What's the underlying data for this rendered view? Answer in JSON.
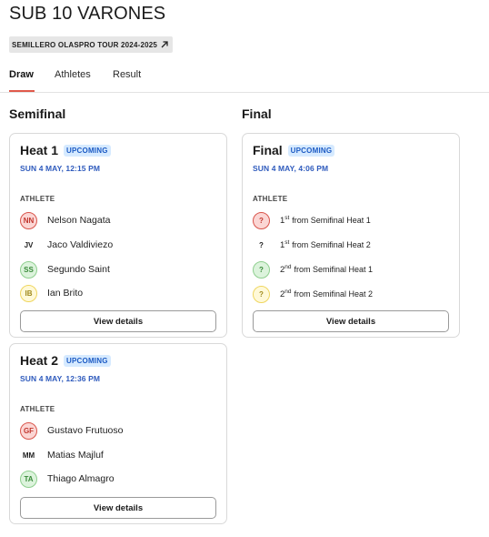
{
  "page": {
    "title": "SUB 10 VARONES"
  },
  "tour_tag": {
    "label": "SEMILLERO OLASPRO TOUR 2024-2025",
    "icon": "arrow-up-right-icon"
  },
  "tabs": [
    {
      "label": "Draw",
      "active": true
    },
    {
      "label": "Athletes",
      "active": false
    },
    {
      "label": "Result",
      "active": false
    }
  ],
  "columns": {
    "semifinal": "Semifinal",
    "final": "Final"
  },
  "heats": {
    "heat1": {
      "title": "Heat 1",
      "status": "UPCOMING",
      "datetime": "SUN 4 MAY, 12:15 PM",
      "athlete_label": "ATHLETE",
      "athletes": [
        {
          "initials": "NN",
          "name": "Nelson Nagata",
          "color": "#d9554c"
        },
        {
          "initials": "JV",
          "name": "Jaco Valdiviezo",
          "color": "#ffffff"
        },
        {
          "initials": "SS",
          "name": "Segundo Saint",
          "color": "#8fcf8f"
        },
        {
          "initials": "IB",
          "name": "Ian Brito",
          "color": "#efd660"
        }
      ],
      "button": "View details"
    },
    "heat2": {
      "title": "Heat 2",
      "status": "UPCOMING",
      "datetime": "SUN 4 MAY, 12:36 PM",
      "athlete_label": "ATHLETE",
      "athletes": [
        {
          "initials": "GF",
          "name": "Gustavo Frutuoso",
          "color": "#d9554c"
        },
        {
          "initials": "MM",
          "name": "Matias Majluf",
          "color": "#ffffff"
        },
        {
          "initials": "TA",
          "name": "Thiago Almagro",
          "color": "#8fcf8f"
        }
      ],
      "button": "View details"
    },
    "final": {
      "title": "Final",
      "status": "UPCOMING",
      "datetime": "SUN 4 MAY, 4:06 PM",
      "athlete_label": "ATHLETE",
      "slots": [
        {
          "initials": "?",
          "ord_num": "1",
          "ord_suffix": "st",
          "source": "from Semifinal Heat 1",
          "color": "#d9554c"
        },
        {
          "initials": "?",
          "ord_num": "1",
          "ord_suffix": "st",
          "source": "from Semifinal Heat 2",
          "color": "#ffffff"
        },
        {
          "initials": "?",
          "ord_num": "2",
          "ord_suffix": "nd",
          "source": "from Semifinal Heat 1",
          "color": "#8fcf8f"
        },
        {
          "initials": "?",
          "ord_num": "2",
          "ord_suffix": "nd",
          "source": "from Semifinal Heat 2",
          "color": "#efd660"
        }
      ],
      "button": "View details"
    }
  },
  "colors": {
    "accent_underline": "#e05a4b",
    "badge_text": "#1d5bc4",
    "badge_bg": "#d6eaff",
    "date_text": "#2f5bbd"
  }
}
